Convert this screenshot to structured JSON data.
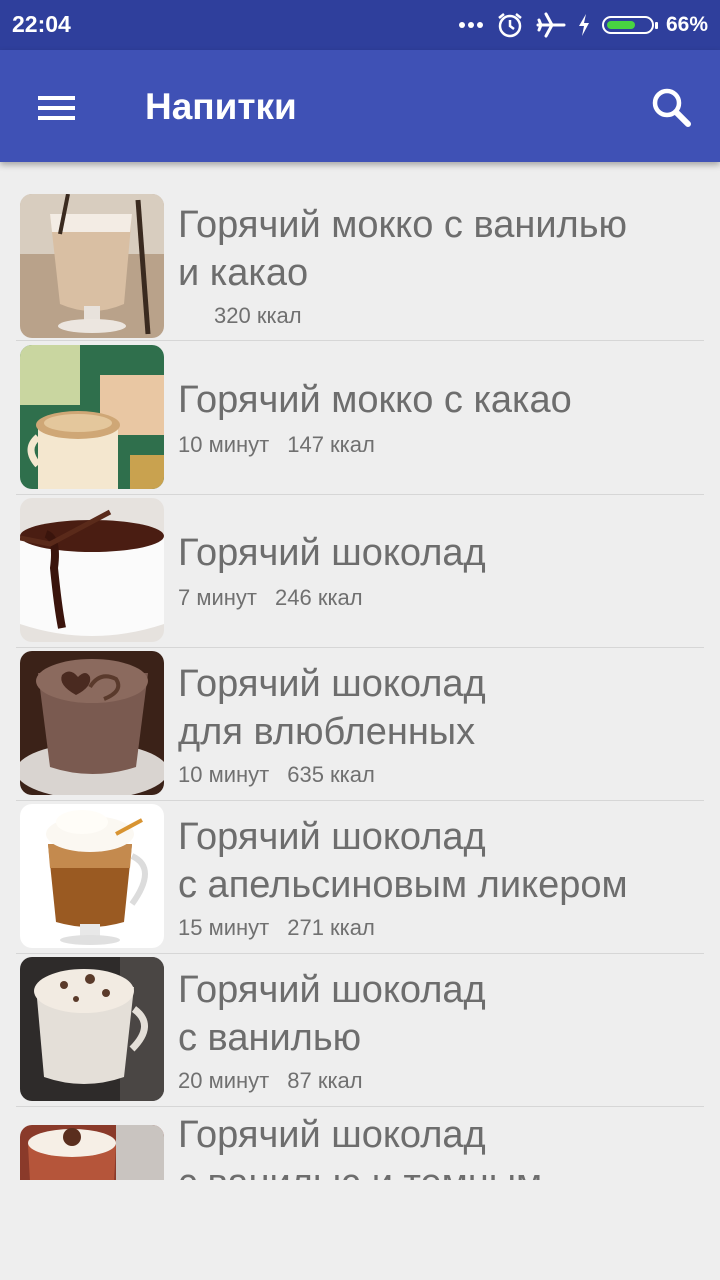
{
  "status_bar": {
    "time": "22:04",
    "battery_percent": "66%",
    "battery_level": 0.66,
    "icons": [
      "more-dots-icon",
      "alarm-icon",
      "airplane-icon",
      "charging-icon",
      "battery-icon"
    ]
  },
  "app_bar": {
    "title": "Напитки",
    "menu_icon": "hamburger-menu-icon",
    "search_icon": "search-icon",
    "color": "#3f51b5"
  },
  "recipes": [
    {
      "name": "Горячий мокко с ванилью\nи какао",
      "time": "",
      "kcal": "320 ккал"
    },
    {
      "name": "Горячий мокко с какао",
      "time": "10 минут",
      "kcal": "147 ккал"
    },
    {
      "name": "Горячий шоколад",
      "time": "7 минут",
      "kcal": "246 ккал"
    },
    {
      "name": "Горячий шоколад\nдля влюбленных",
      "time": "10 минут",
      "kcal": "635 ккал"
    },
    {
      "name": "Горячий шоколад\nс апельсиновым ликером",
      "time": "15 минут",
      "kcal": "271 ккал"
    },
    {
      "name": "Горячий шоколад\nс ванилью",
      "time": "20 минут",
      "kcal": "87 ккал"
    },
    {
      "name": "Горячий шоколад\nс ванилью и темным",
      "time": "",
      "kcal": ""
    }
  ]
}
